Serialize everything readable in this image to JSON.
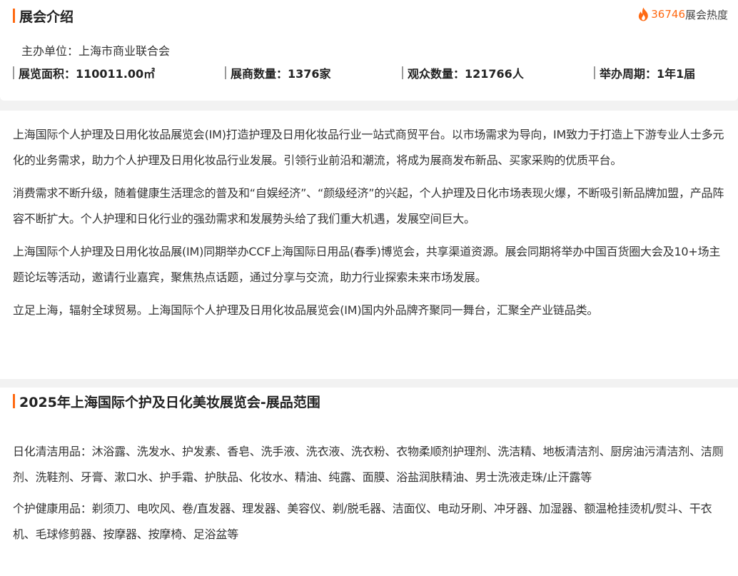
{
  "intro": {
    "title": "展会介绍",
    "heat_value": "36746",
    "heat_label": "展会热度",
    "organizer": "主办单位：上海市商业联合会",
    "stats": [
      {
        "label": "展览面积：",
        "value": "110011.00㎡"
      },
      {
        "label": "展商数量：",
        "value": "1376家"
      },
      {
        "label": "观众数量：",
        "value": "121766人"
      },
      {
        "label": "举办周期：",
        "value": "1年1届"
      }
    ]
  },
  "description": {
    "paragraphs": [
      "上海国际个人护理及日用化妆品展览会(IM)打造护理及日用化妆品行业一站式商贸平台。以市场需求为导向，IM致力于打造上下游专业人士多元化的业务需求，助力个人护理及日用化妆品行业发展。引领行业前沿和潮流，将成为展商发布新品、买家采购的优质平台。",
      "消费需求不断升级，随着健康生活理念的普及和“自娱经济”、“颜级经济”的兴起，个人护理及日化市场表现火爆，不断吸引新品牌加盟，产品阵容不断扩大。个人护理和日化行业的强劲需求和发展势头给了我们重大机遇，发展空间巨大。",
      "上海国际个人护理及日用化妆品展(IM)同期举办CCF上海国际日用品(春季)博览会，共享渠道资源。展会同期将举办中国百货圈大会及10+场主题论坛等活动，邀请行业嘉宾，聚焦热点话题，通过分享与交流，助力行业探索未来市场发展。",
      "立足上海，辐射全球贸易。上海国际个人护理及日用化妆品展览会(IM)国内外品牌齐聚同一舞台，汇聚全产业链品类。"
    ]
  },
  "range": {
    "title": "2025年上海国际个护及日化美妆展览会-展品范围",
    "items": [
      "日化清洁用品：沐浴露、洗发水、护发素、香皂、洗手液、洗衣液、洗衣粉、衣物柔顺剂护理剂、洗洁精、地板清洁剂、厨房油污清洁剂、洁厕剂、洗鞋剂、牙膏、漱口水、护手霜、护肤品、化妆水、精油、纯露、面膜、浴盐润肤精油、男士洗液走珠/止汗露等",
      "个护健康用品：剃须刀、电吹风、卷/直发器、理发器、美容仪、剃/脱毛器、洁面仪、电动牙刷、冲牙器、加湿器、额温枪挂烫机/熨斗、干衣机、毛球修剪器、按摩器、按摩椅、足浴盆等"
    ]
  },
  "colors": {
    "accent": "#ff6a13",
    "text": "#333333",
    "background": "#f2f2f2"
  },
  "icons": {
    "heat": "fire-icon"
  }
}
